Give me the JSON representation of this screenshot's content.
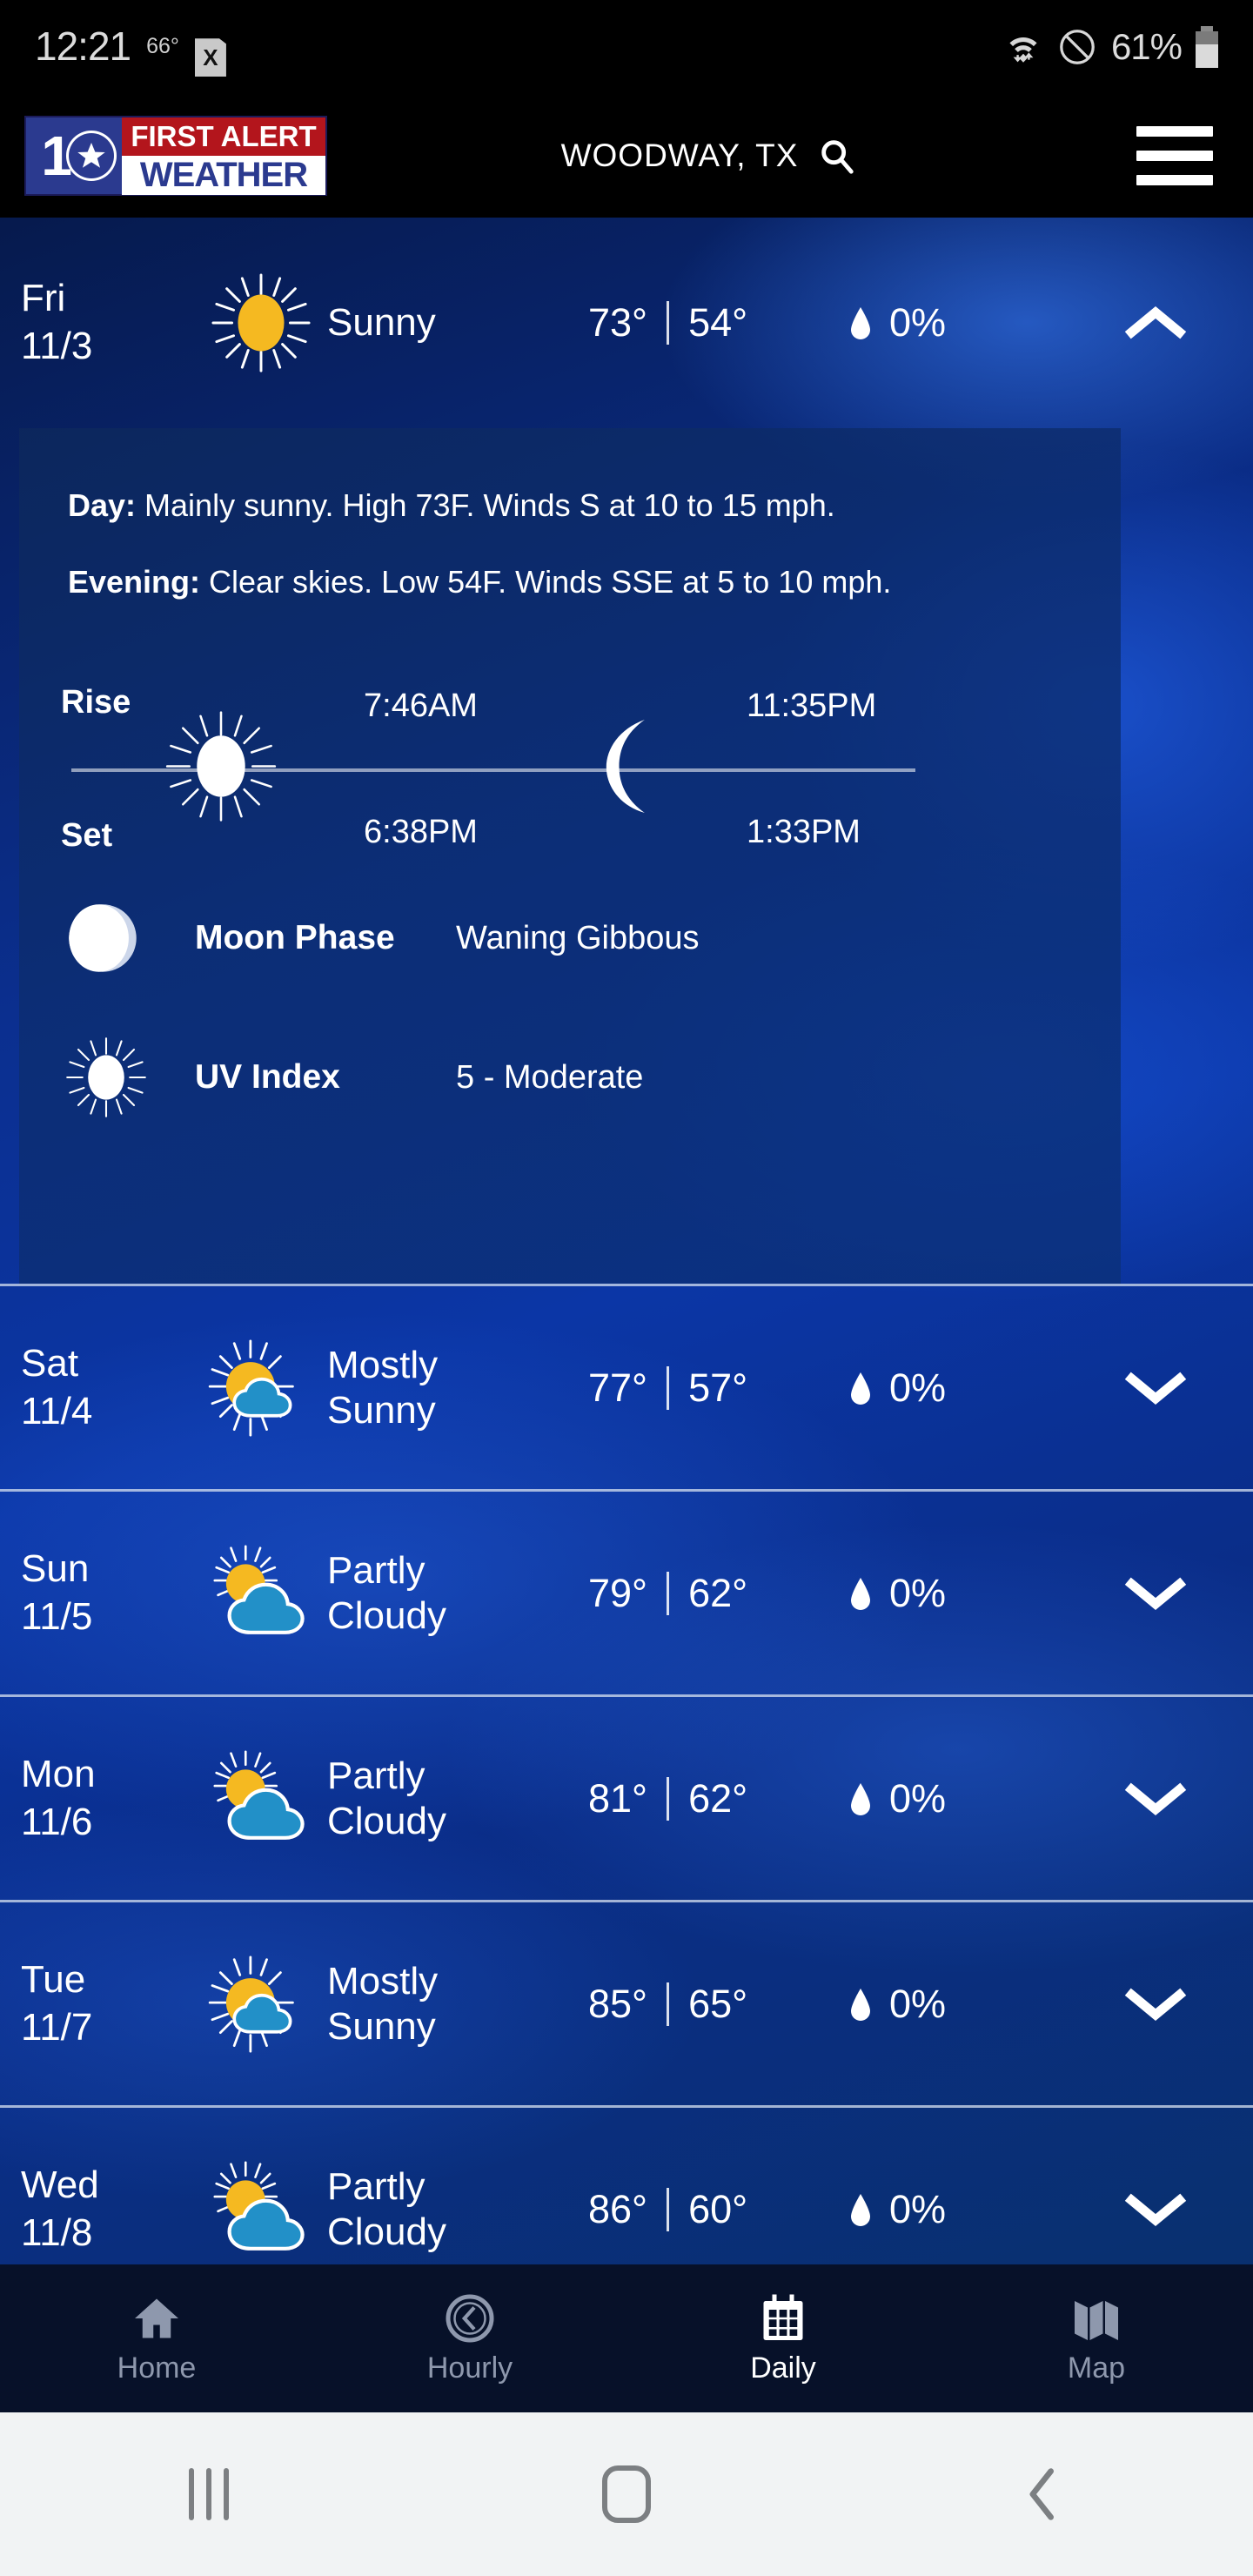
{
  "status_bar": {
    "time": "12:21",
    "temperature": "66°",
    "x_icon_label": "X",
    "battery_percent": "61%",
    "icons": [
      "wifi-icon",
      "do-not-disturb-icon",
      "battery-icon"
    ]
  },
  "app_bar": {
    "logo": {
      "channel": "10",
      "line1": "FIRST ALERT",
      "line2": "WEATHER"
    },
    "location": "WOODWAY, TX",
    "search_icon": "search-icon",
    "menu_icon": "hamburger-menu-icon"
  },
  "colors": {
    "sun": "#f5b921",
    "cloud": "#2290c8",
    "logo_red": "#b3151c",
    "logo_blue": "#2b3a8f",
    "panel": "#0d2a66",
    "accent_white": "#ffffff"
  },
  "selected_day": {
    "day": "Fri",
    "date": "11/3",
    "icon": "sunny-icon",
    "condition": "Sunny",
    "high": "73°",
    "low": "54°",
    "precip": "0%",
    "expanded": true,
    "chevron": "chevron-up-icon",
    "detail": {
      "day_label": "Day:",
      "day_text": "Mainly sunny. High 73F. Winds S at 10 to 15 mph.",
      "evening_label": "Evening:",
      "evening_text": "Clear skies. Low 54F. Winds SSE at 5 to 10 mph.",
      "rise_label": "Rise",
      "set_label": "Set",
      "sunrise": "7:46AM",
      "sunset": "6:38PM",
      "moonrise": "11:35PM",
      "moonset": "1:33PM",
      "moon_phase_label": "Moon Phase",
      "moon_phase_value": "Waning Gibbous",
      "uv_label": "UV Index",
      "uv_value": "5 - Moderate"
    }
  },
  "forecast_days": [
    {
      "day": "Sat",
      "date": "11/4",
      "icon": "mostly-sunny-icon",
      "condition_l1": "Mostly",
      "condition_l2": "Sunny",
      "high": "77°",
      "low": "57°",
      "precip": "0%",
      "chevron": "chevron-down-icon"
    },
    {
      "day": "Sun",
      "date": "11/5",
      "icon": "partly-cloudy-icon",
      "condition_l1": "Partly",
      "condition_l2": "Cloudy",
      "high": "79°",
      "low": "62°",
      "precip": "0%",
      "chevron": "chevron-down-icon"
    },
    {
      "day": "Mon",
      "date": "11/6",
      "icon": "partly-cloudy-icon",
      "condition_l1": "Partly",
      "condition_l2": "Cloudy",
      "high": "81°",
      "low": "62°",
      "precip": "0%",
      "chevron": "chevron-down-icon"
    },
    {
      "day": "Tue",
      "date": "11/7",
      "icon": "mostly-sunny-icon",
      "condition_l1": "Mostly",
      "condition_l2": "Sunny",
      "high": "85°",
      "low": "65°",
      "precip": "0%",
      "chevron": "chevron-down-icon"
    },
    {
      "day": "Wed",
      "date": "11/8",
      "icon": "partly-cloudy-icon",
      "condition_l1": "Partly",
      "condition_l2": "Cloudy",
      "high": "86°",
      "low": "60°",
      "precip": "0%",
      "chevron": "chevron-down-icon"
    }
  ],
  "tab_bar": {
    "active": "Daily",
    "items": [
      {
        "label": "Home",
        "icon": "home-icon"
      },
      {
        "label": "Hourly",
        "icon": "clock-icon"
      },
      {
        "label": "Daily",
        "icon": "calendar-icon"
      },
      {
        "label": "Map",
        "icon": "map-icon"
      }
    ]
  },
  "android_nav": {
    "recents": "recents-icon",
    "home": "home-square-icon",
    "back": "back-chevron-icon"
  }
}
